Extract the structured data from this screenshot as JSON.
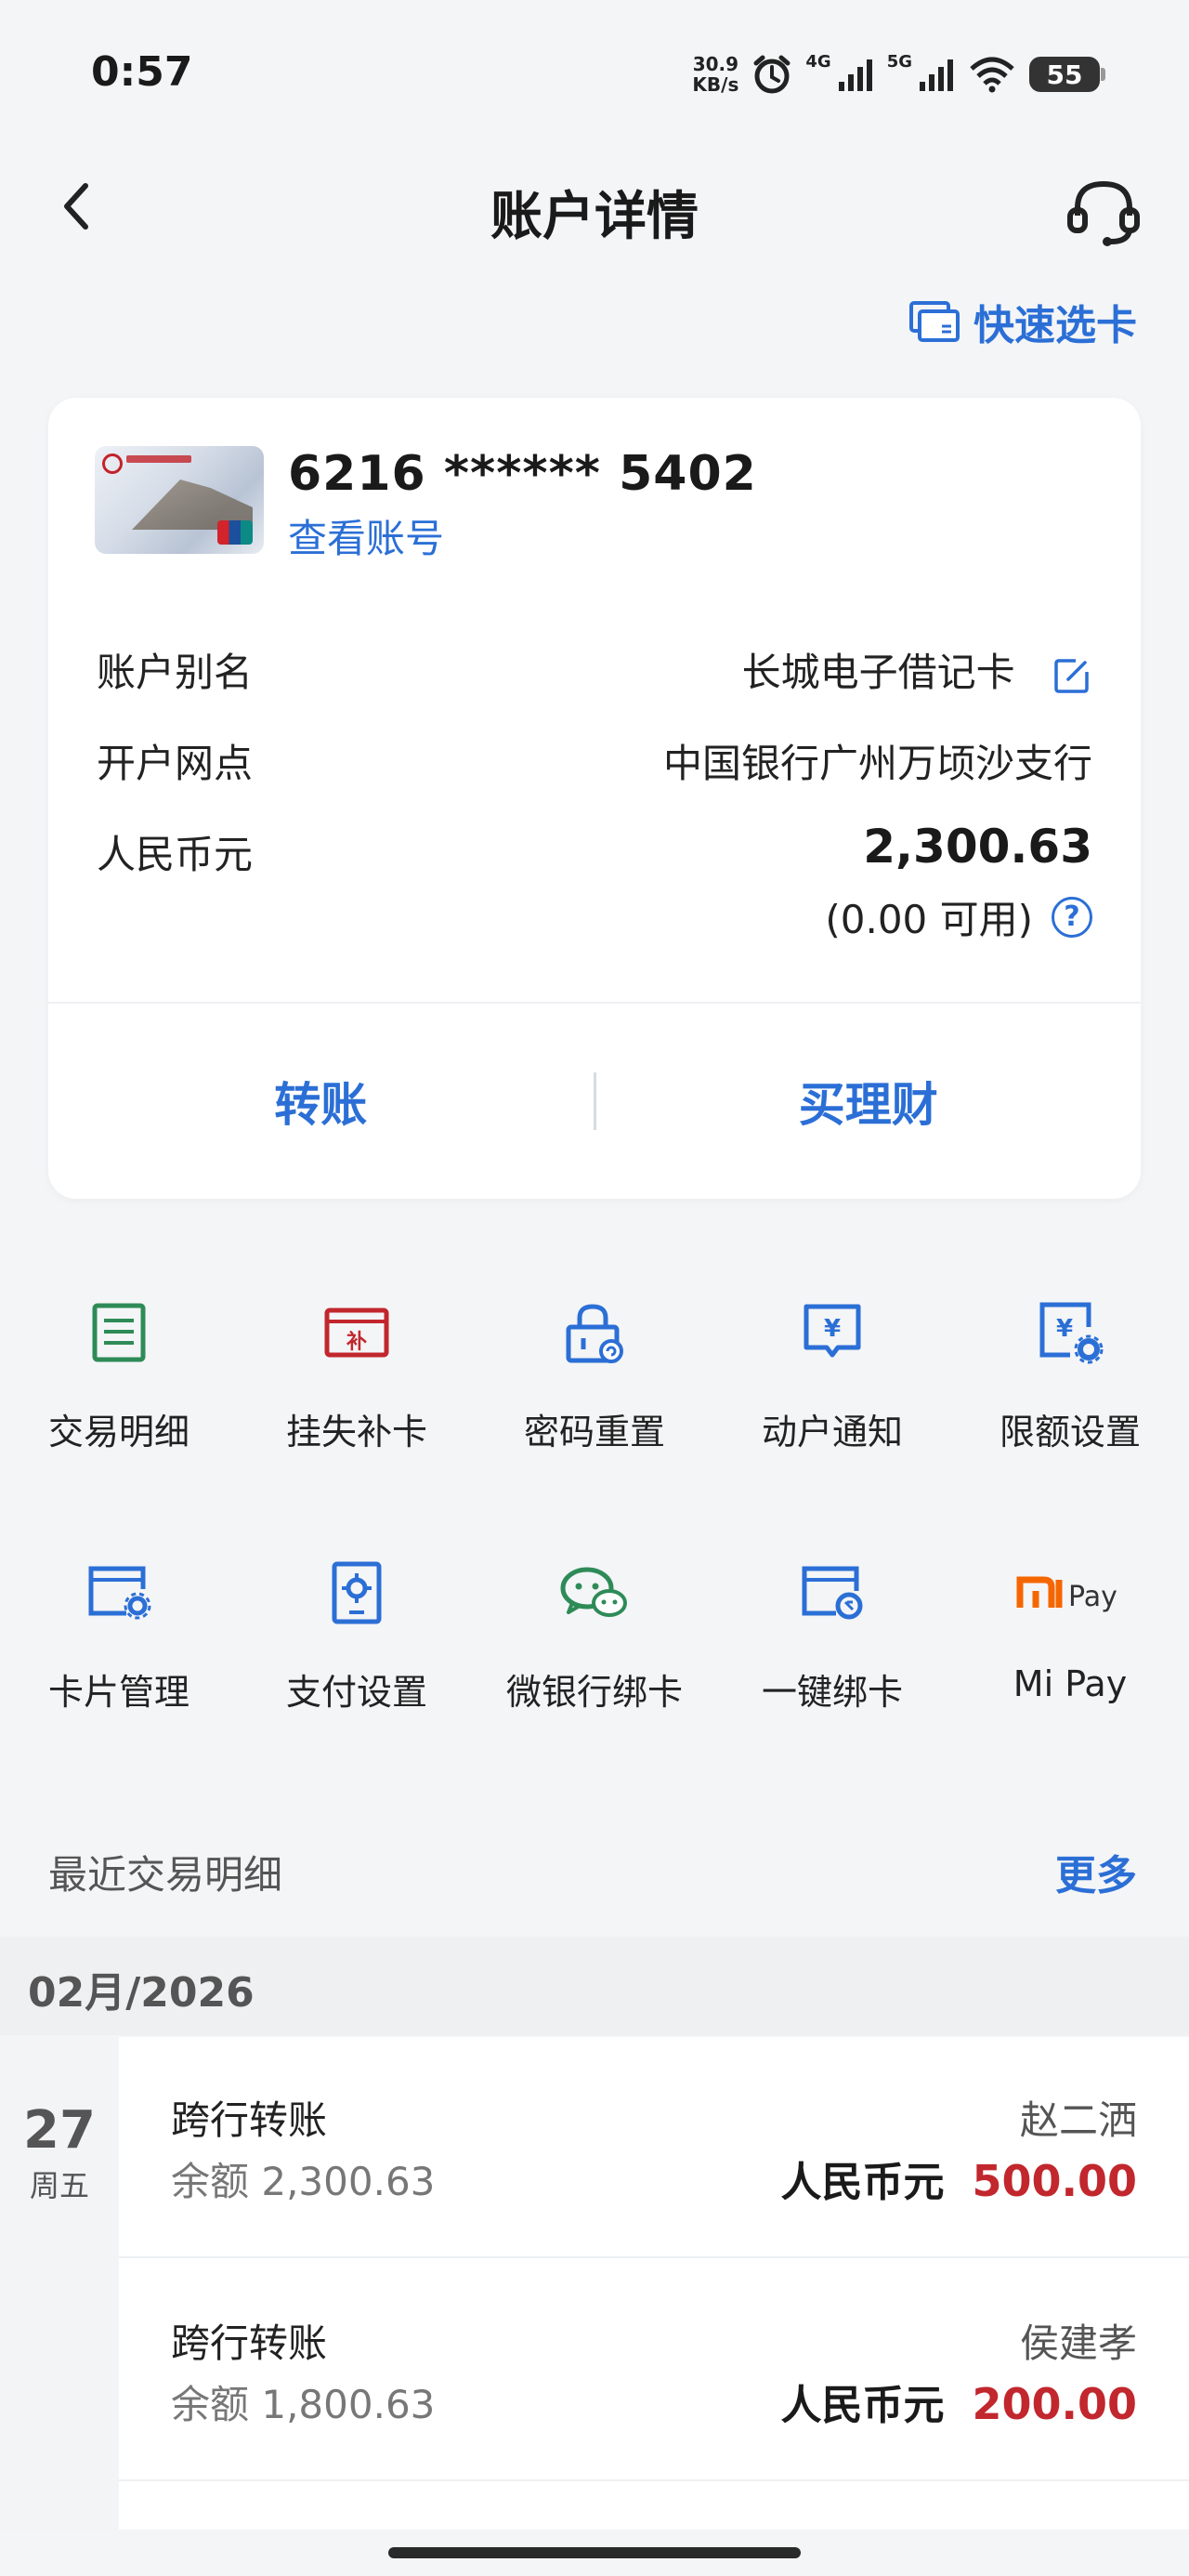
{
  "status_bar": {
    "time": "0:57",
    "speed": [
      "30.9",
      "KB/s"
    ],
    "net_4g": "4G",
    "net_5g": "5G",
    "battery": "55"
  },
  "header": {
    "title": "账户详情",
    "quick_select": "快速选卡"
  },
  "account": {
    "card_number": "6216 ****** 5402",
    "view_number": "查看账号",
    "rows": [
      {
        "label": "账户别名",
        "value": "长城电子借记卡"
      },
      {
        "label": "开户网点",
        "value": "中国银行广州万顷沙支行"
      },
      {
        "label": "人民币元",
        "value": "2,300.63"
      }
    ],
    "available": "(0.00 可用)",
    "help_icon_text": "?",
    "actions": [
      "转账",
      "买理财"
    ]
  },
  "services": {
    "row1": [
      {
        "label": "交易明细",
        "icon": "list-icon",
        "color": "#2e8b57"
      },
      {
        "label": "挂失补卡",
        "icon": "card-lost-icon",
        "color": "#c1272d",
        "glyph": "补"
      },
      {
        "label": "密码重置",
        "icon": "lock-reset-icon",
        "color": "#2b6fd6"
      },
      {
        "label": "动户通知",
        "icon": "notify-yuan-icon",
        "color": "#2b6fd6",
        "glyph": "¥"
      },
      {
        "label": "限额设置",
        "icon": "limit-settings-icon",
        "color": "#2b6fd6",
        "glyph": "¥"
      }
    ],
    "row2": [
      {
        "label": "卡片管理",
        "icon": "card-gear-icon",
        "color": "#2b6fd6"
      },
      {
        "label": "支付设置",
        "icon": "payment-settings-icon",
        "color": "#2b6fd6"
      },
      {
        "label": "微银行绑卡",
        "icon": "wechat-icon",
        "color": "#2e8b57"
      },
      {
        "label": "一键绑卡",
        "icon": "card-bind-icon",
        "color": "#2b6fd6"
      },
      {
        "label": "Mi Pay",
        "icon": "mipay-icon",
        "color": "#f56600",
        "logo_text": "Pay"
      }
    ]
  },
  "recent": {
    "title": "最近交易明细",
    "more": "更多",
    "month": "02月/2026",
    "date_day": "27",
    "date_weekday": "周五",
    "transactions": [
      {
        "type": "跨行转账",
        "balance": "余额 2,300.63",
        "counterparty": "赵二洒",
        "currency": "人民币元",
        "amount": "500.00"
      },
      {
        "type": "跨行转账",
        "balance": "余额 1,800.63",
        "counterparty": "侯建孝",
        "currency": "人民币元",
        "amount": "200.00"
      }
    ]
  }
}
